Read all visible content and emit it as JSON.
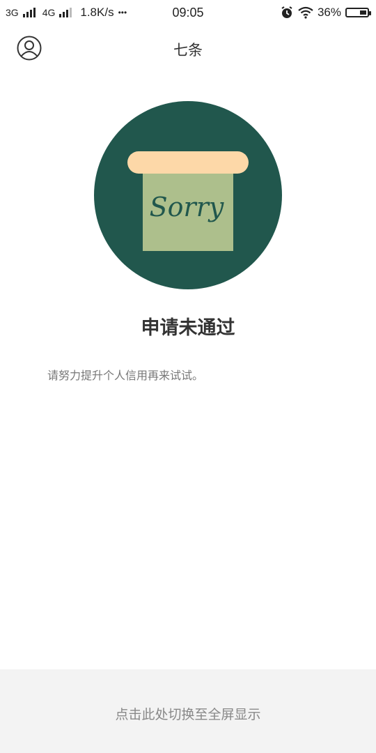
{
  "status_bar": {
    "network1": "3G",
    "network2": "4G",
    "speed": "1.8K/s",
    "more": "•••",
    "time": "09:05",
    "battery": "36%",
    "battery_level": 0.36
  },
  "header": {
    "title": "七条",
    "avatar_icon": "user-avatar-icon"
  },
  "hero": {
    "sign_text": "Sorry",
    "colors": {
      "circle": "#21574d",
      "bar": "#fdd8a8",
      "paper": "#adbf8c",
      "text": "#21574d"
    }
  },
  "result": {
    "title": "申请未通过",
    "description": "请努力提升个人信用再来试试。"
  },
  "footer": {
    "label": "点击此处切换至全屏显示"
  }
}
